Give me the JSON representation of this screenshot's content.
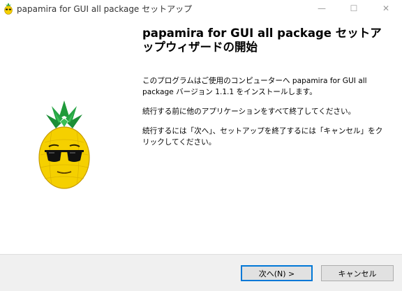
{
  "window": {
    "title": "papamira for GUI all package セットアップ",
    "minimize_glyph": "—",
    "maximize_glyph": "☐",
    "close_glyph": "✕"
  },
  "wizard": {
    "heading": "papamira for GUI all package セットアップウィザードの開始",
    "paragraph1": "このプログラムはご使用のコンピューターへ papamira for GUI all package バージョン 1.1.1 をインストールします。",
    "paragraph2": "続行する前に他のアプリケーションをすべて終了してください。",
    "paragraph3": "続行するには「次へ」、セットアップを終了するには「キャンセル」をクリックしてください。"
  },
  "buttons": {
    "next_label": "次へ(N) >",
    "cancel_label": "キャンセル"
  },
  "icons": {
    "app": "pineapple-icon",
    "mascot": "pineapple-mascot-with-sunglasses"
  },
  "colors": {
    "accent": "#0078d7",
    "pineapple_body": "#f5d000",
    "leaves": "#1f9a3a"
  }
}
